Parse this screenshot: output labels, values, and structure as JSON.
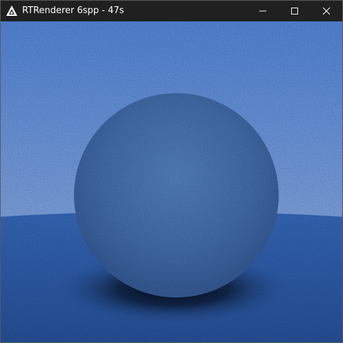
{
  "window": {
    "title": "RTRenderer 6spp - 47s",
    "controls": {
      "minimize_icon": "minimize-icon",
      "maximize_icon": "maximize-icon",
      "close_icon": "close-icon"
    },
    "app_icon": "triangle-logo-icon"
  },
  "render": {
    "sky_top_color": "#5b93ef",
    "sky_bottom_color": "#a7c6fb",
    "ground_color": "#2e63b8",
    "sphere_color": "#4a78bd"
  }
}
